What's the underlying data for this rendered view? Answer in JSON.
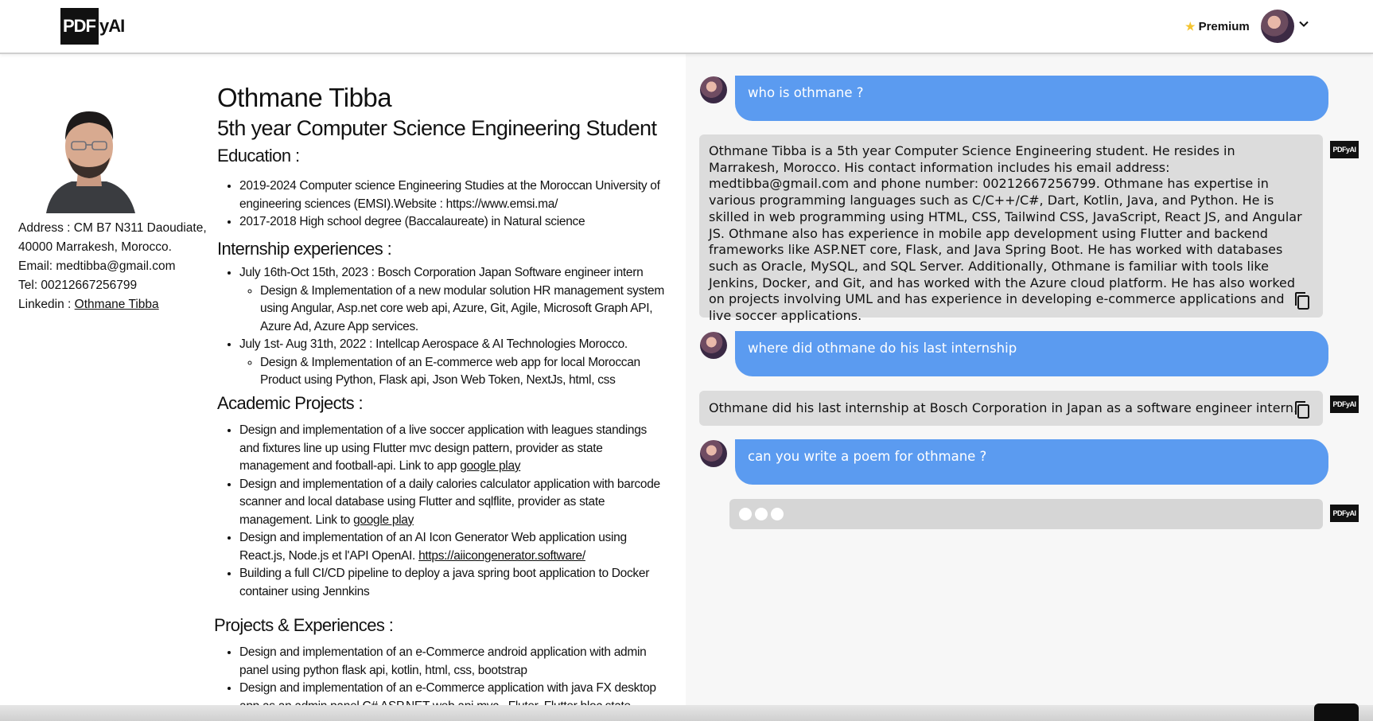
{
  "header": {
    "logo_box": "PDF",
    "logo_rest": "yAI",
    "premium_label": "Premium",
    "colors": {
      "accent": "#5b9bf0",
      "star": "#f4c430"
    }
  },
  "resume": {
    "name": "Othmane Tibba",
    "title": "5th year Computer Science Engineering Student",
    "contact": {
      "address_line1": "Address : CM B7 N311 Daoudiate,",
      "address_line2": "40000 Marrakesh, Morocco.",
      "email": "Email: medtibba@gmail.com",
      "tel": "Tel: 00212667256799",
      "linkedin_label": "Linkedin : ",
      "linkedin_link": "Othmane Tibba"
    },
    "education": {
      "heading": "Education :",
      "items": [
        "2019-2024 Computer science Engineering Studies at the Moroccan University of engineering sciences (EMSI).Website : https://www.emsi.ma/",
        "2017-2018 High school degree (Baccalaureate) in Natural science"
      ]
    },
    "internships": {
      "heading": "Internship experiences :",
      "items": [
        {
          "title": "July 16th-Oct 15th, 2023 : Bosch Corporation Japan Software engineer intern",
          "detail": "Design & Implementation of a new modular solution HR management system using  Angular,  Asp.net core web api, Azure, Git, Agile, Microsoft Graph API, Azure Ad, Azure App services."
        },
        {
          "title": "July 1st- Aug 31th, 2022 : Intellcap Aerospace & AI Technologies Morocco.",
          "detail": "Design & Implementation of an E-commerce web app  for local Moroccan Product  using Python, Flask api, Json Web Token, NextJs, html, css"
        }
      ]
    },
    "academic": {
      "heading": "Academic Projects :",
      "items": [
        {
          "text": "Design and implementation of a live soccer application with leagues standings and fixtures line up using Flutter mvc design pattern, provider as state management and football-api. Link to app ",
          "link": "google play"
        },
        {
          "text": "Design and implementation of a daily calories calculator application with barcode scanner and local database using Flutter and sqlflite, provider as state management. Link to ",
          "link": "google play"
        },
        {
          "text": "Design and implementation of an AI Icon Generator Web application using React.js, Node.js et l'API OpenAI. ",
          "link": "https://aiicongenerator.software/"
        },
        {
          "text": "Building a full CI/CD pipeline  to deploy a java spring boot application to Docker container using Jennkins",
          "link": ""
        }
      ]
    },
    "projects": {
      "heading": "Projects & Experiences :",
      "items": [
        "Design and implementation of an e-Commerce android application with admin panel using python flask api, kotlin, html, css, bootstrap",
        "Design and implementation of an e-Commerce application with java FX desktop app as an admin panel C# ASP.NET web api mvc , Fluter, Flutter bloc state management"
      ]
    }
  },
  "chat": {
    "bot_logo": "PDFyAI",
    "messages": [
      {
        "role": "user",
        "text": "who is othmane ?"
      },
      {
        "role": "bot",
        "text": "Othmane Tibba is a 5th year Computer Science Engineering student. He resides in Marrakesh, Morocco. His contact information includes his email address: medtibba@gmail.com and phone number: 00212667256799. Othmane has expertise in various programming languages such as C/C++/C#, Dart, Kotlin, Java, and Python. He is skilled in web programming using HTML, CSS, Tailwind CSS, JavaScript, React JS, and Angular JS. Othmane also has experience in mobile app development using Flutter and backend frameworks like ASP.NET core, Flask, and Java Spring Boot. He has worked with databases such as Oracle, MySQL, and SQL Server. Additionally, Othmane is familiar with tools like Jenkins, Docker, and Git, and has worked with the Azure cloud platform. He has also worked on projects involving UML and has experience in developing e-commerce applications and live soccer applications."
      },
      {
        "role": "user",
        "text": "where did othmane do his last internship"
      },
      {
        "role": "bot",
        "text": "Othmane did his last internship at Bosch Corporation in Japan as a software engineer intern."
      },
      {
        "role": "user",
        "text": "can you write a poem for othmane ?"
      }
    ]
  }
}
